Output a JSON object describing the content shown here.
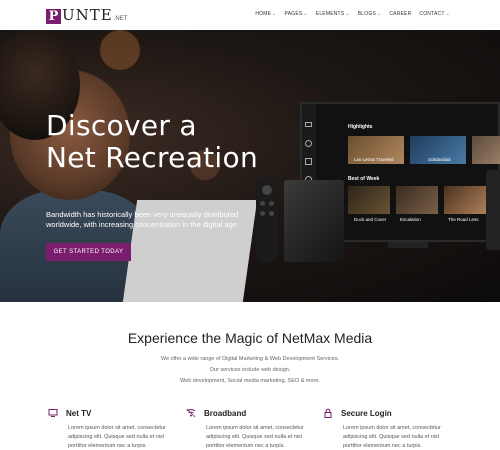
{
  "brand": {
    "logo_letter": "P",
    "logo_rest": "UNTE",
    "logo_tld": ".NET",
    "accent": "#7a1d6d"
  },
  "nav": {
    "items": [
      {
        "label": "HOME",
        "dropdown": true
      },
      {
        "label": "PAGES",
        "dropdown": true
      },
      {
        "label": "ELEMENTS",
        "dropdown": true
      },
      {
        "label": "BLOGS",
        "dropdown": true
      },
      {
        "label": "CAREER",
        "dropdown": false
      },
      {
        "label": "CONTACT",
        "dropdown": true
      }
    ]
  },
  "hero": {
    "title_line1": "Discover a",
    "title_line2": "Net Recreation",
    "subtitle": "Bandwidth has historically been very unequally distributed worldwide, with increasing concentration in the digital age",
    "cta": "GET STARTED TODAY",
    "tv": {
      "section1": "Highlights",
      "section2": "Best of Week",
      "highlights": [
        "Las Letras Traveled",
        "Solidaridad"
      ],
      "week": [
        "Duck and Cover",
        "Escalation",
        "The Road Less"
      ]
    }
  },
  "section": {
    "title": "Experience the Magic of NetMax Media",
    "lines": [
      "We offer a wide range of Digital Marketing & Web Development Services.",
      "Our services include web design,",
      "Web development, Social media marketing, SEO & more."
    ]
  },
  "features": [
    {
      "icon": "monitor-icon",
      "title": "Net TV",
      "text": "Lorem ipsum dolor sit amet, consectetur adipiscing elit. Quisque sed nulla et nisl porttitor elementum nec a turpis."
    },
    {
      "icon": "broadband-icon",
      "title": "Broadband",
      "text": "Lorem ipsum dolor sit amet, consectetur adipiscing elit. Quisque sed nulla et nisl porttitor elementum nec a turpis."
    },
    {
      "icon": "lock-icon",
      "title": "Secure Login",
      "text": "Lorem ipsum dolor sit amet, consectetur adipiscing elit. Quisque sed nulla et nisl porttitor elementum nec a turpis."
    }
  ]
}
